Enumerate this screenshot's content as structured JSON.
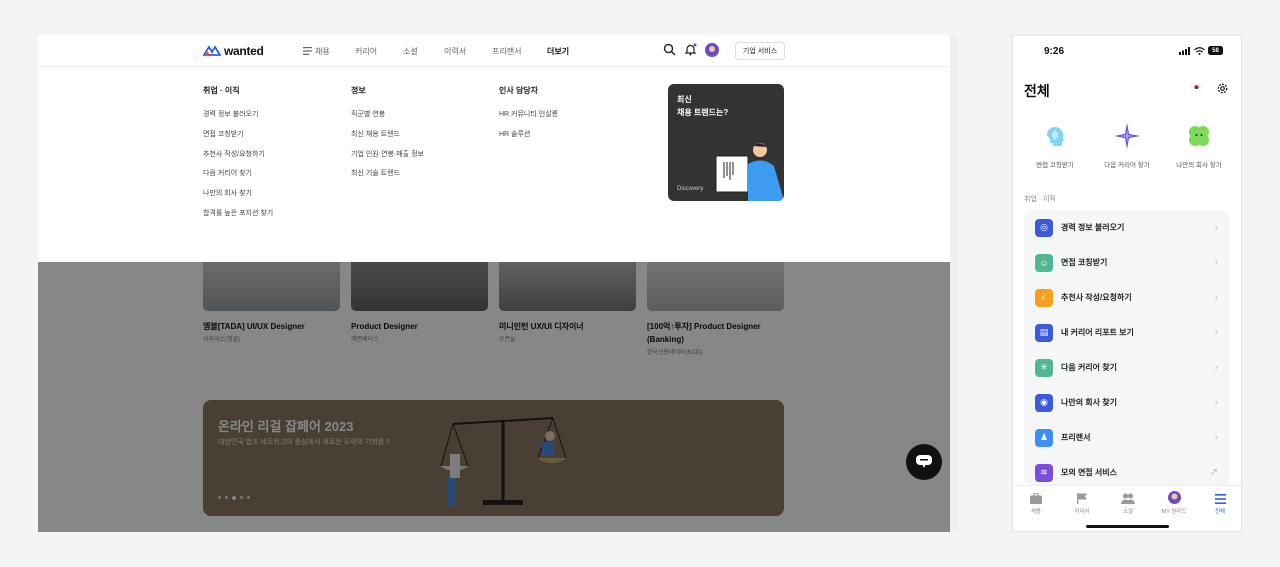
{
  "desktop": {
    "logo": "wanted",
    "nav": [
      {
        "label": "채용"
      },
      {
        "label": "커리어"
      },
      {
        "label": "소셜"
      },
      {
        "label": "이력서"
      },
      {
        "label": "프리랜서"
      },
      {
        "label": "더보기",
        "active": true
      }
    ],
    "business_button": "기업 서비스",
    "mega_menu": {
      "columns": [
        {
          "heading": "취업 · 이직",
          "items": [
            "경력 정보 불러오기",
            "면접 코칭받기",
            "추천사 작성/요청하기",
            "다음 커리어 찾기",
            "나만의 회사 찾기",
            "합격률 높은 포지션 찾기"
          ]
        },
        {
          "heading": "정보",
          "items": [
            "직군별 연봉",
            "최신 채용 트렌드",
            "기업 인원·연봉·매출 정보",
            "최신 기술 트렌드"
          ]
        },
        {
          "heading": "인사 담당자",
          "items": [
            "HR 커뮤니티 인살롱",
            "HR 솔루션"
          ]
        }
      ],
      "promo": {
        "title": "최신\n채용 트렌드는?",
        "tag": "Discovery"
      }
    },
    "job_cards": [
      {
        "title": "엠블[TADA] UI/UX Designer",
        "company": "이지식스(엠블)"
      },
      {
        "title": "Product Designer",
        "company": "레몬베이스"
      },
      {
        "title": "미니인턴 UX/UI 디자이너",
        "company": "오픈놀"
      },
      {
        "title": "[100억↑투자] Product Designer (Banking)",
        "company": "한국신용데이터(KCD)"
      }
    ],
    "banner": {
      "title": "온라인 리걸 잡페어 2023",
      "subtitle": "대한민국 법조 네트워크의 중심에서 새로운 도약의 기회를 !!",
      "slides": 5,
      "active_slide": 3
    }
  },
  "mobile": {
    "time": "9:26",
    "battery": "58",
    "title": "전체",
    "quick_links": [
      {
        "label": "면접 코칭받기",
        "icon": "ai-head-icon"
      },
      {
        "label": "다음 커리어 찾기",
        "icon": "sparkle-icon"
      },
      {
        "label": "나만의 회사 찾기",
        "icon": "clover-icon"
      }
    ],
    "section_label": "취업 · 이직",
    "menu": [
      {
        "label": "경력 정보 불러오기",
        "color": "#3b5bdb",
        "icon": "target-icon",
        "glyph": "◎",
        "trailing": "›"
      },
      {
        "label": "면접 코칭받기",
        "color": "#4fb88f",
        "icon": "face-icon",
        "glyph": "☺",
        "trailing": "›"
      },
      {
        "label": "추천사 작성/요청하기",
        "color": "#f59f1a",
        "icon": "thumbs-up-icon",
        "glyph": "✓",
        "trailing": "›"
      },
      {
        "label": "내 커리어 리포트 보기",
        "color": "#3b5bdb",
        "icon": "report-icon",
        "glyph": "▤",
        "trailing": "›"
      },
      {
        "label": "다음 커리어 찾기",
        "color": "#4fb88f",
        "icon": "sparkle-icon",
        "glyph": "✳",
        "trailing": "›"
      },
      {
        "label": "나만의 회사 찾기",
        "color": "#3b5bdb",
        "icon": "company-icon",
        "glyph": "◉",
        "trailing": "›"
      },
      {
        "label": "프리랜서",
        "color": "#3d8ff5",
        "icon": "person-icon",
        "glyph": "♟",
        "trailing": "›"
      },
      {
        "label": "모의 면접 서비스",
        "color": "#7c4ddb",
        "icon": "audio-icon",
        "glyph": "≋",
        "trailing": "↗"
      }
    ],
    "tabs": [
      {
        "label": "채용",
        "icon": "briefcase-icon"
      },
      {
        "label": "커리어",
        "icon": "flag-icon"
      },
      {
        "label": "소셜",
        "icon": "people-icon"
      },
      {
        "label": "MY 원티드",
        "icon": "avatar-icon"
      },
      {
        "label": "전체",
        "icon": "menu-icon",
        "active": true
      }
    ]
  }
}
